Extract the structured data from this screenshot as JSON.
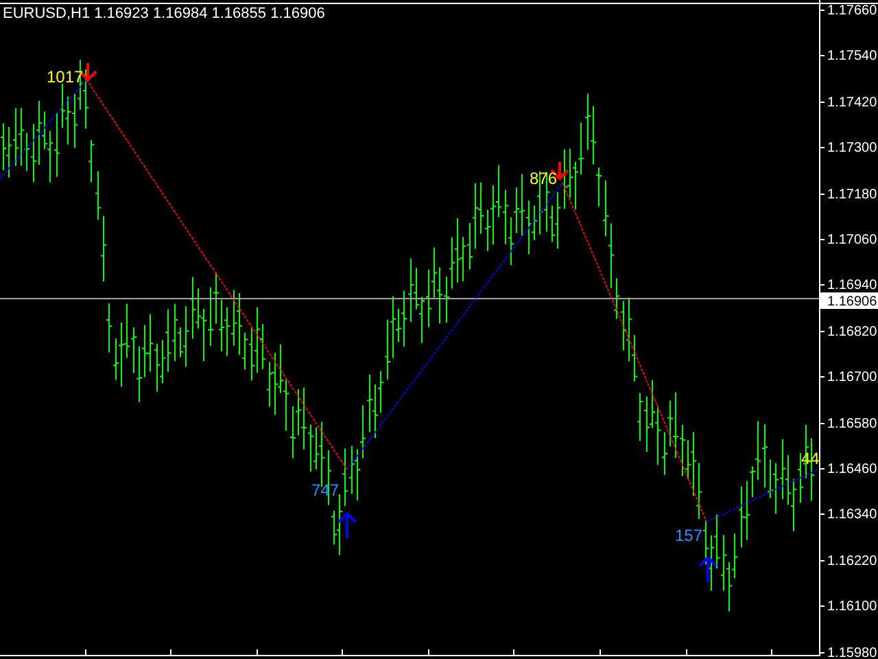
{
  "header": {
    "symbol": "EURUSD,H1",
    "open": "1.16923",
    "high": "1.16984",
    "low": "1.16855",
    "close": "1.16906"
  },
  "price_axis": {
    "ticks": [
      "1.17660",
      "1.17540",
      "1.17420",
      "1.17300",
      "1.17180",
      "1.17060",
      "1.16940",
      "1.16820",
      "1.16700",
      "1.16580",
      "1.16460",
      "1.16340",
      "1.16220",
      "1.16100",
      "1.15980"
    ],
    "current_price": "1.16906"
  },
  "zigzag_labels": [
    {
      "text": "1017",
      "kind": "peak",
      "color": "#ffff00"
    },
    {
      "text": "747",
      "kind": "trough",
      "color": "#1e90ff"
    },
    {
      "text": "876",
      "kind": "peak",
      "color": "#ffff00"
    },
    {
      "text": "157",
      "kind": "trough",
      "color": "#1e90ff"
    },
    {
      "text": "44",
      "kind": "current",
      "color": "#ffff00"
    }
  ]
}
